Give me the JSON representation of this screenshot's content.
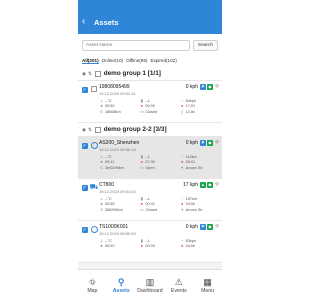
{
  "header": {
    "title": "Assets"
  },
  "search": {
    "placeholder": "Asset Name",
    "button": "Search"
  },
  "filters": [
    "All(201)",
    "Online(10)",
    "Offline(89)",
    "Expired(102)"
  ],
  "groups": [
    {
      "name": "demo group 1 [1/1]",
      "assets": [
        {
          "name": "19808095499",
          "speed": "0 kph",
          "timestamp": "19.12.2024 09:01:11",
          "cells": [
            [
              "--°C",
              "--L",
              "84kph"
            ],
            [
              "00:50",
              "00:00",
              "17:01"
            ],
            [
              "18668km",
              "Closed",
              "12.8v"
            ]
          ]
        }
      ]
    },
    {
      "name": "demo group 2-2 [3/3]",
      "assets": [
        {
          "name": "AS200_Shenzhen",
          "speed": "0 kph",
          "timestamp": "19.12.2024 08:56:13",
          "cells": [
            [
              "--°C",
              "--L",
              "110km"
            ],
            [
              "00:11",
              "07:30",
              "05:01"
            ],
            [
              "3m0299km",
              "Open",
              "Aroom Sh"
            ]
          ]
        },
        {
          "name": "CT800",
          "speed": "17 kph",
          "timestamp": "19.12.2024 09:01:44",
          "cells": [
            [
              "--°C",
              "--L",
              "167km"
            ],
            [
              "00:55",
              "00:41",
              "04:0e"
            ],
            [
              "286992km",
              "Closed",
              "Aroom Sh"
            ]
          ]
        },
        {
          "name": "TS1000K001",
          "speed": "0 kph",
          "timestamp": "19.12.2024 08:52:49",
          "cells": [
            [
              "--°C",
              "--L",
              "83kph"
            ],
            [
              "00:50",
              "00:00",
              "04:0e"
            ],
            [
              "",
              "",
              ""
            ]
          ]
        }
      ]
    }
  ],
  "nav": [
    "Map",
    "Assets",
    "Dashboard",
    "Events",
    "Menu"
  ]
}
